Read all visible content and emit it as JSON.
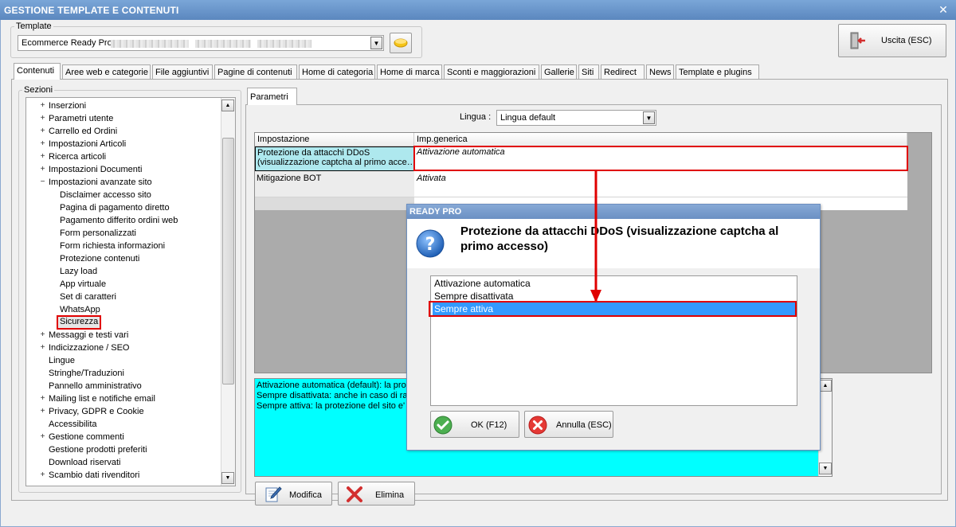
{
  "window": {
    "title": "GESTIONE TEMPLATE E CONTENUTI",
    "close_glyph": "✕"
  },
  "template": {
    "group_label": "Template",
    "selected": "Ecommerce Ready Pro",
    "open_icon": "folder-open-icon"
  },
  "exit_button": {
    "label": "Uscita (ESC)",
    "icon": "exit-door-icon"
  },
  "tabs": [
    {
      "label": "Contenuti",
      "active": true
    },
    {
      "label": "Aree web e categorie"
    },
    {
      "label": "File aggiuntivi"
    },
    {
      "label": "Pagine di contenuti"
    },
    {
      "label": "Home di categoria"
    },
    {
      "label": "Home di marca"
    },
    {
      "label": "Sconti e maggiorazioni"
    },
    {
      "label": "Gallerie"
    },
    {
      "label": "Siti"
    },
    {
      "label": "Redirect"
    },
    {
      "label": "News"
    },
    {
      "label": "Template e plugins"
    }
  ],
  "sections": {
    "group_label": "Sezioni",
    "items": [
      {
        "label": "Inserzioni",
        "expander": "+"
      },
      {
        "label": "Parametri utente",
        "expander": "+"
      },
      {
        "label": "Carrello ed Ordini",
        "expander": "+"
      },
      {
        "label": "Impostazioni Articoli",
        "expander": "+"
      },
      {
        "label": "Ricerca articoli",
        "expander": "+"
      },
      {
        "label": "Impostazioni Documenti",
        "expander": "+"
      },
      {
        "label": "Impostazioni avanzate sito",
        "expander": "−"
      },
      {
        "label": "Disclaimer accesso sito",
        "child": true
      },
      {
        "label": "Pagina di pagamento diretto",
        "child": true
      },
      {
        "label": "Pagamento differito ordini web",
        "child": true
      },
      {
        "label": "Form personalizzati",
        "child": true
      },
      {
        "label": "Form richiesta informazioni",
        "child": true
      },
      {
        "label": "Protezione contenuti",
        "child": true
      },
      {
        "label": "Lazy load",
        "child": true
      },
      {
        "label": "App virtuale",
        "child": true
      },
      {
        "label": "Set di caratteri",
        "child": true
      },
      {
        "label": "WhatsApp",
        "child": true
      },
      {
        "label": "Sicurezza",
        "child": true,
        "selected": true
      },
      {
        "label": "Messaggi e testi vari",
        "expander": "+"
      },
      {
        "label": "Indicizzazione / SEO",
        "expander": "+"
      },
      {
        "label": "Lingue"
      },
      {
        "label": "Stringhe/Traduzioni"
      },
      {
        "label": "Pannello amministrativo"
      },
      {
        "label": "Mailing list e notifiche email",
        "expander": "+"
      },
      {
        "label": "Privacy, GDPR e Cookie",
        "expander": "+"
      },
      {
        "label": "Accessibilita"
      },
      {
        "label": "Gestione commenti",
        "expander": "+"
      },
      {
        "label": "Gestione prodotti preferiti"
      },
      {
        "label": "Download riservati"
      },
      {
        "label": "Scambio dati rivenditori",
        "expander": "+"
      }
    ]
  },
  "params": {
    "tab_label": "Parametri",
    "language_label": "Lingua :",
    "language_value": "Lingua default",
    "columns": [
      "Impostazione",
      "Imp.generica"
    ],
    "rows": [
      {
        "setting": "Protezione da attacchi DDoS\n(visualizzazione captcha al primo acce…",
        "value": "Attivazione automatica"
      },
      {
        "setting": "Mitigazione BOT",
        "value": "Attivata"
      }
    ],
    "description_lines": [
      "Attivazione automatica (default): la pro",
      "Sempre disattivata: anche in caso di ral",
      "Sempre attiva: la protezione del sito e' s"
    ],
    "modify_label": "Modifica",
    "delete_label": "Elimina"
  },
  "dialog": {
    "title": "READY PRO",
    "question": "Protezione da attacchi DDoS (visualizzazione captcha al primo accesso)",
    "options": [
      "Attivazione automatica",
      "Sempre disattivata",
      "Sempre attiva"
    ],
    "selected_index": 2,
    "ok_label": "OK (F12)",
    "cancel_label": "Annulla (ESC)"
  },
  "colors": {
    "accent_red": "#e00000",
    "selection_blue": "#3399ff",
    "highlight_cyan": "#00ffff",
    "title_blue": "#5b87be"
  }
}
